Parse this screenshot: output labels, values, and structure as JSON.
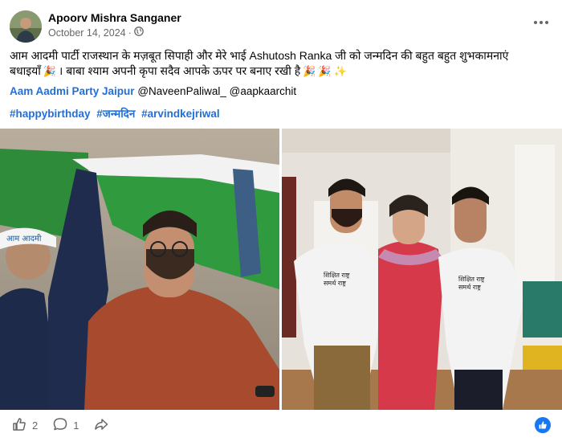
{
  "post": {
    "author": "Apoorv Mishra Sanganer",
    "date": "October 14, 2024",
    "separator": "·",
    "privacy_icon": "globe-icon",
    "text_line1": "आम आदमी पार्टी राजस्थान के मज़बूत सिपाही और मेरे भाई Ashutosh Ranka जी को जन्मदिन की बहुत बहुत शुभकामनाएं",
    "text_line2_a": "बधाइयाँ",
    "text_line2_b": "। बाबा श्याम अपनी कृपा सदैव आपके ऊपर पर बनाए रखी है",
    "emoji_party": "🎉",
    "emoji_sparkles": "✨",
    "mentions": {
      "page": "Aam Aadmi Party Jaipur",
      "user1": "@NaveenPaliwal_",
      "user2": "@aapkaarchit"
    },
    "hashtags": [
      "#happybirthday",
      "#जन्मदिन",
      "#arvindkejriwal"
    ],
    "photo1_shirt_text": "आम आदमी",
    "photo2_shirt_text_1": "शिक्षित राष्ट्र",
    "photo2_shirt_text_2": "समर्थ राष्ट्र"
  },
  "actions": {
    "like_count": "2",
    "comment_count": "1",
    "like_icon": "thumbs-up-icon",
    "comment_icon": "comment-icon",
    "share_icon": "share-icon"
  },
  "colors": {
    "link": "#216fdb",
    "secondary_text": "#65676b",
    "facebook_blue": "#1877f2"
  }
}
